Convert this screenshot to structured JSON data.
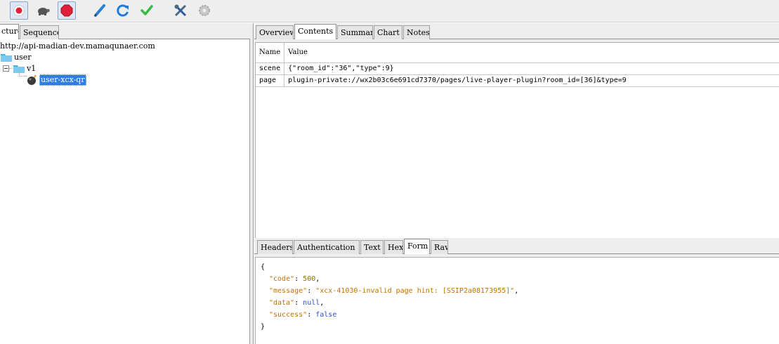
{
  "toolbar": {
    "buttons": [
      {
        "name": "record-icon",
        "pressed": true
      },
      {
        "name": "throttle-turtle-icon",
        "pressed": false
      },
      {
        "name": "stop-icon",
        "pressed": true
      },
      {
        "name": "edit-pen-icon",
        "pressed": false
      },
      {
        "name": "refresh-icon",
        "pressed": false
      },
      {
        "name": "validate-check-icon",
        "pressed": false
      },
      {
        "name": "tools-icon",
        "pressed": false
      },
      {
        "name": "settings-gear-icon",
        "pressed": false
      }
    ],
    "colors": {
      "record": "#e0203a",
      "stop": "#e0203a",
      "pen": "#2a7fd4",
      "refresh": "#1b7ed6",
      "check": "#3cb84a"
    }
  },
  "left_tabs": [
    "cture",
    "Sequence"
  ],
  "tree": {
    "host": "http://api-madian-dev.mamaqunaer.com",
    "folder1": "user",
    "folder2": "v1",
    "leaf": "user-xcx-qr"
  },
  "right_tabs": [
    "Overview",
    "Contents",
    "Summary",
    "Chart",
    "Notes"
  ],
  "params": {
    "columns": [
      "Name",
      "Value"
    ],
    "rows": [
      {
        "name": "scene",
        "value": "{\"room_id\":\"36\",\"type\":9}"
      },
      {
        "name": "page",
        "value": "plugin-private://wx2b03c6e691cd7370/pages/live-player-plugin?room_id=[36]&type=9"
      }
    ]
  },
  "bottom_tabs": [
    "Headers",
    "Authentication",
    "Text",
    "Hex",
    "Form",
    "Raw"
  ],
  "response": {
    "open": "{",
    "close": "}",
    "lines": [
      {
        "key": "\"code\"",
        "value": "500",
        "type": "number",
        "comma": ","
      },
      {
        "key": "\"message\"",
        "value": "\"xcx-41030-invalid page hint: [SSIP2a08173955]\"",
        "type": "string",
        "comma": ","
      },
      {
        "key": "\"data\"",
        "value": "null",
        "type": "keyword",
        "comma": ","
      },
      {
        "key": "\"success\"",
        "value": "false",
        "type": "keyword",
        "comma": ""
      }
    ]
  }
}
